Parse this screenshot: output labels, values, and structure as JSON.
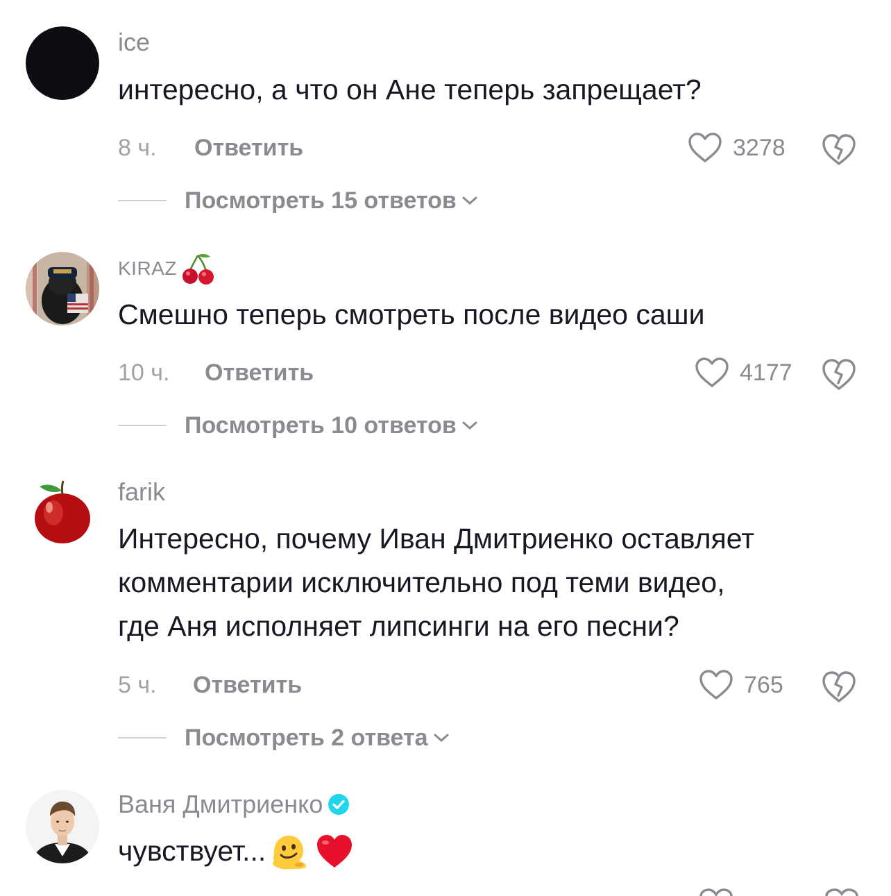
{
  "comments": [
    {
      "username": "ice",
      "text": "интересно, а что он Ане теперь запрещает?",
      "time": "8 ч.",
      "reply_label": "Ответить",
      "likes": "3278",
      "view_replies": "Посмотреть 15 ответов",
      "avatar": "black-circle"
    },
    {
      "username": "KIRAZ",
      "username_emoji": "cherry-icon",
      "text": "Смешно теперь смотреть после видео саши",
      "time": "10 ч.",
      "reply_label": "Ответить",
      "likes": "4177",
      "view_replies": "Посмотреть 10 ответов",
      "avatar": "dog-in-navy-cap-photo"
    },
    {
      "username": "farik",
      "text": "Интересно, почему Иван Дмитриенко оставляет\nкомментарии исключительно под теми видео,\nгде Аня исполняет липсинги на его песни?",
      "time": "5 ч.",
      "reply_label": "Ответить",
      "likes": "765",
      "view_replies": "Посмотреть 2 ответа",
      "avatar": "red-apple-photo"
    },
    {
      "username": "Ваня Дмитриенко",
      "verified": true,
      "text": "чувствует...",
      "text_emojis": [
        "melting-face-icon",
        "red-heart-icon"
      ],
      "avatar": "man-portrait-photo"
    }
  ],
  "colors": {
    "text": "#161823",
    "muted": "#8a8b91",
    "time": "#a1a2a7",
    "verified": "#20d5ec",
    "heart_red": "#e8112d"
  }
}
